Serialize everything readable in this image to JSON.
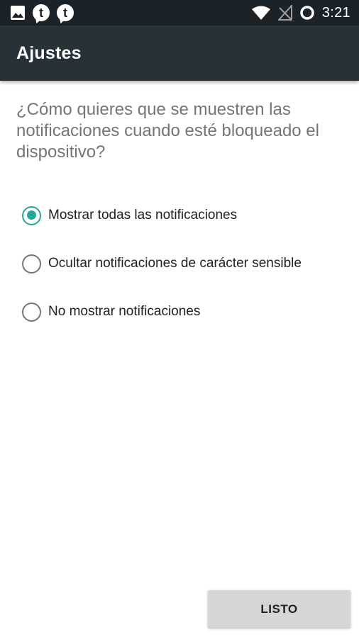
{
  "status_bar": {
    "left_icons": [
      "image-icon",
      "talk-icon",
      "talk-icon"
    ],
    "notif_glyph": "t",
    "right_icons": [
      "wifi-icon",
      "no-signal-icon",
      "battery-ring-icon"
    ],
    "time": "3:21"
  },
  "app_bar": {
    "title": "Ajustes",
    "background": "#263238"
  },
  "question": "¿Cómo quieres que se muestren las notificaciones cuando esté bloqueado el dispositivo?",
  "options": [
    {
      "label": "Mostrar todas las notificaciones",
      "selected": true
    },
    {
      "label": "Ocultar notificaciones de carácter sensible",
      "selected": false
    },
    {
      "label": "No mostrar notificaciones",
      "selected": false
    }
  ],
  "done_button": {
    "label": "LISTO"
  },
  "colors": {
    "accent": "#26a69a",
    "status_bar": "#1b2228",
    "button_bg": "#d6d6d6"
  }
}
